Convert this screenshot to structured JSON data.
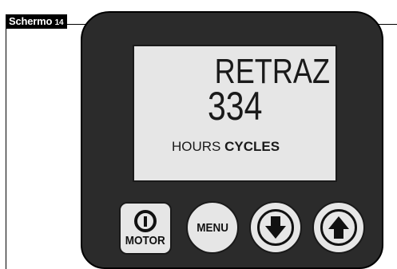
{
  "screen_tag": {
    "label": "Schermo",
    "number": "14"
  },
  "lcd": {
    "line1": "RETRAZ",
    "line2": "334",
    "hours_label": "HOURS",
    "cycles_label": "CYCLES"
  },
  "buttons": {
    "motor_label": "MOTOR",
    "menu_label": "MENU",
    "down_icon": "arrow-down-icon",
    "up_icon": "arrow-up-icon",
    "power_icon": "power-icon"
  },
  "colors": {
    "device_body": "#2b2b2b",
    "lcd_background": "#e6e6e6",
    "text": "#1a1a1a"
  }
}
